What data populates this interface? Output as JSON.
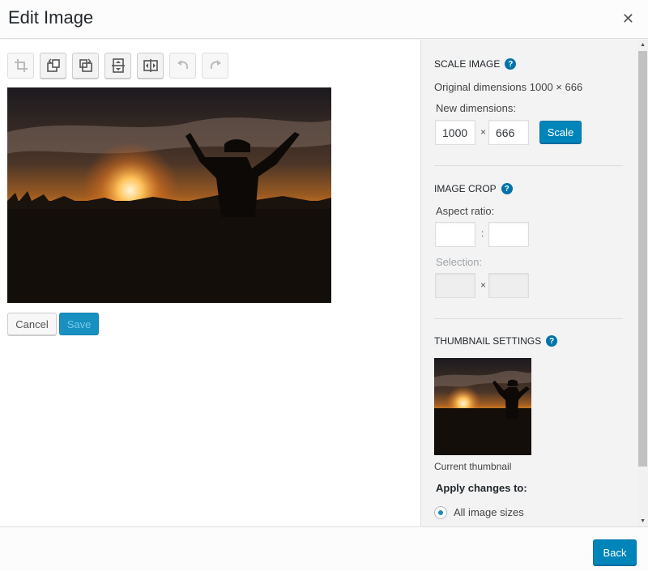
{
  "header": {
    "title": "Edit Image"
  },
  "toolbar": {
    "buttons": [
      {
        "name": "crop-icon",
        "disabled": true
      },
      {
        "name": "rotate-left-icon",
        "disabled": false
      },
      {
        "name": "rotate-right-icon",
        "disabled": false
      },
      {
        "name": "flip-vertical-icon",
        "disabled": false
      },
      {
        "name": "flip-horizontal-icon",
        "disabled": false
      },
      {
        "name": "undo-icon",
        "disabled": true
      },
      {
        "name": "redo-icon",
        "disabled": true
      }
    ]
  },
  "editor": {
    "cancel_label": "Cancel",
    "save_label": "Save"
  },
  "scale": {
    "title": "Scale Image",
    "original": "Original dimensions 1000 × 666",
    "new_label": "New dimensions:",
    "width": "1000",
    "height": "666",
    "times": "×",
    "button": "Scale"
  },
  "crop": {
    "title": "Image Crop",
    "aspect_label": "Aspect ratio:",
    "aspect_w": "",
    "aspect_h": "",
    "colon": ":",
    "selection_label": "Selection:",
    "sel_w": "",
    "sel_h": "",
    "times": "×"
  },
  "thumbnail": {
    "title": "Thumbnail Settings",
    "caption": "Current thumbnail",
    "apply_label": "Apply changes to:",
    "option_all": "All image sizes"
  },
  "footer": {
    "back_label": "Back"
  },
  "colors": {
    "primary": "#0085ba",
    "help": "#0073aa"
  }
}
